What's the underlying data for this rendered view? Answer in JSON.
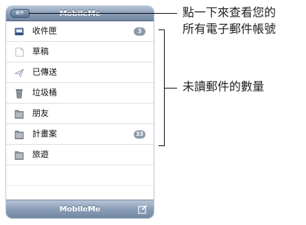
{
  "nav": {
    "back_label": "郵件",
    "title": "MobileMe"
  },
  "mailboxes": [
    {
      "label": "收件匣",
      "icon": "inbox-icon",
      "badge": "3"
    },
    {
      "label": "草稿",
      "icon": "drafts-icon"
    },
    {
      "label": "已傳送",
      "icon": "sent-icon"
    },
    {
      "label": "垃圾桶",
      "icon": "trash-icon"
    },
    {
      "label": "朋友",
      "icon": "folder-icon"
    },
    {
      "label": "計畫案",
      "icon": "folder-icon",
      "badge": "33"
    },
    {
      "label": "旅遊",
      "icon": "folder-icon"
    }
  ],
  "toolbar": {
    "title": "MobileMe",
    "compose_icon": "compose-icon"
  },
  "callouts": {
    "accounts_line1": "點一下來查看您的",
    "accounts_line2": "所有電子郵件帳號",
    "unread": "未讀郵件的數量"
  },
  "colors": {
    "bar_top": "#b7c4d6",
    "bar_bottom": "#72879f",
    "badge": "#8d99ab"
  }
}
